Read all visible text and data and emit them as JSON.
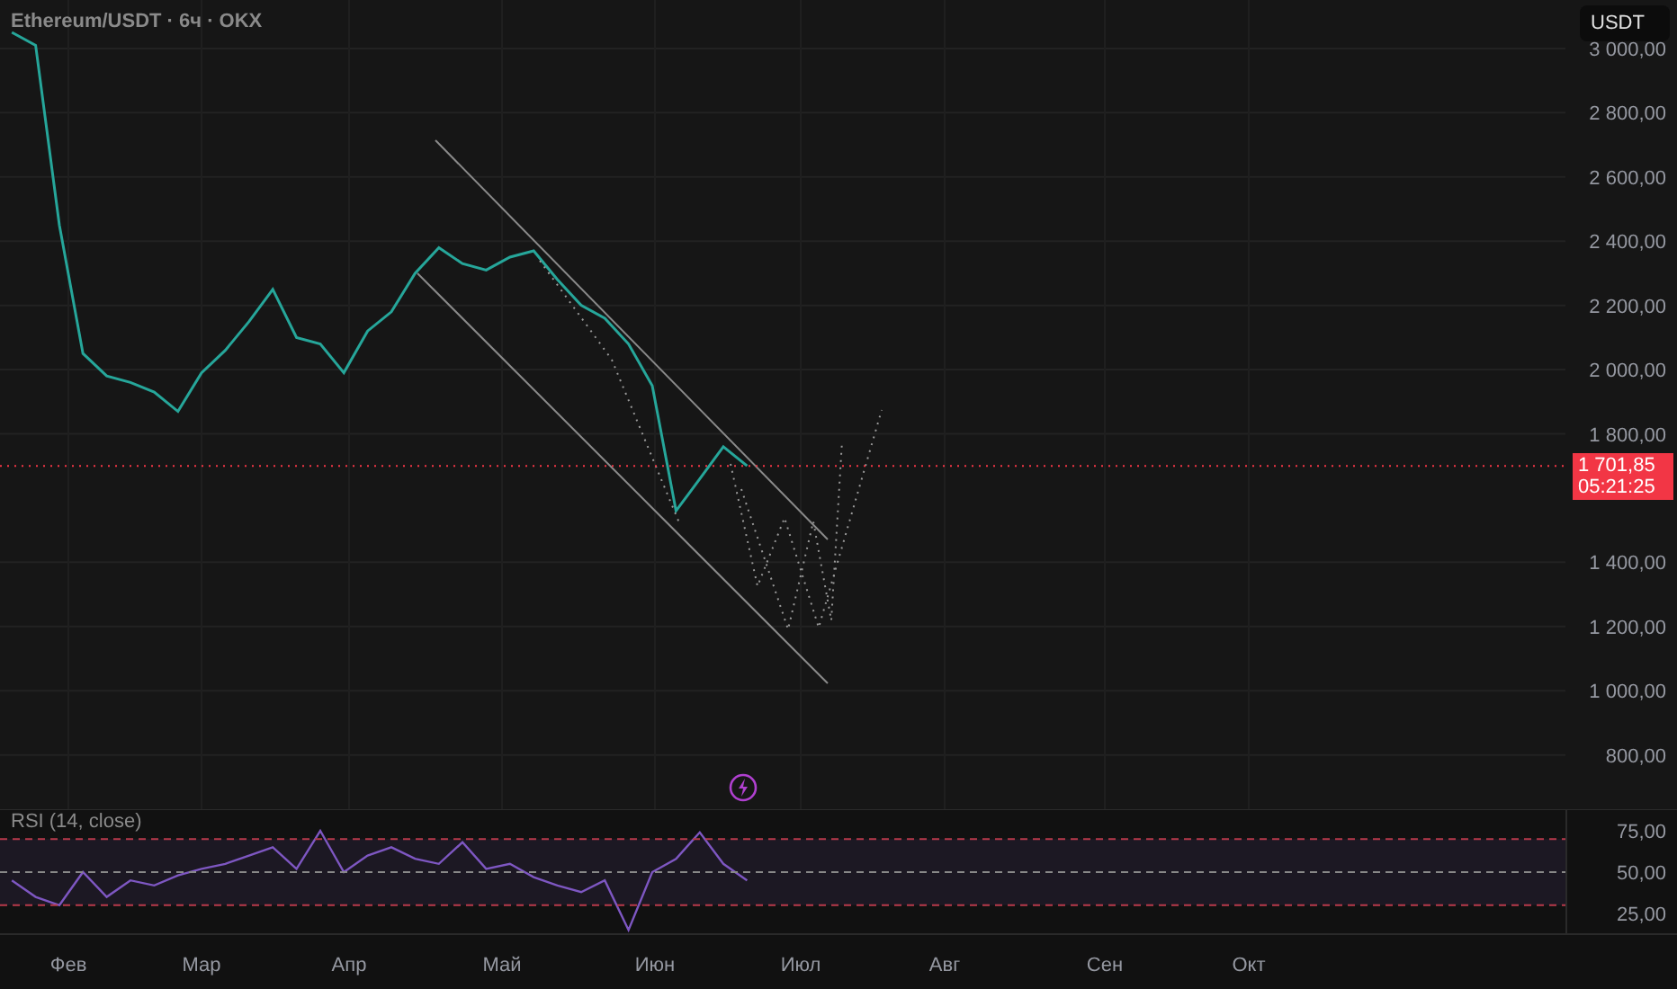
{
  "title": "Ethereum/USDT · 6ч · OKX",
  "currency_button": "USDT",
  "price_chart": {
    "chart_data": {
      "type": "line",
      "grid": true,
      "ylim": [
        631,
        3151
      ],
      "categories": [
        null,
        null,
        null,
        null,
        null,
        null,
        null,
        null,
        null,
        null,
        null,
        null,
        null,
        null,
        null,
        null,
        null,
        null,
        null,
        null,
        null,
        null,
        null,
        null,
        null,
        null,
        null,
        null,
        null,
        null,
        null,
        null,
        null,
        null,
        null,
        null,
        null,
        null,
        null,
        null,
        null,
        null,
        null,
        null,
        null,
        null,
        null,
        null,
        null,
        null,
        null,
        null,
        null,
        null,
        null,
        null,
        null,
        null,
        null,
        null,
        null,
        null,
        null,
        null,
        null,
        null
      ],
      "series": [
        {
          "color": "#26a69a",
          "values": [
            3050,
            3010,
            2450,
            2050,
            1980,
            1960,
            1930,
            1870,
            1990,
            2060,
            2150,
            2250,
            2100,
            2080,
            1990,
            2120,
            2180,
            2300,
            2380,
            2330,
            2310,
            2350,
            2370,
            2280,
            2200,
            2160,
            2080,
            1950,
            1560,
            1660,
            1760,
            1700,
            null,
            null,
            null,
            null,
            null,
            null,
            null,
            null,
            null,
            null,
            null,
            null,
            null,
            null,
            null,
            null,
            null,
            null,
            null,
            null,
            null,
            null,
            null,
            null,
            null,
            null,
            null,
            null,
            null,
            null,
            null,
            null,
            null,
            null
          ]
        }
      ],
      "yticks": [
        {
          "value": 3000,
          "label": "3 000,00"
        },
        {
          "value": 2800,
          "label": "2 800,00"
        },
        {
          "value": 2600,
          "label": "2 600,00"
        },
        {
          "value": 2400,
          "label": "2 400,00"
        },
        {
          "value": 2200,
          "label": "2 200,00"
        },
        {
          "value": 2000,
          "label": "2 000,00"
        },
        {
          "value": 1800,
          "label": "1 800,00"
        },
        {
          "value": 1400,
          "label": "1 400,00"
        },
        {
          "value": 1200,
          "label": "1 200,00"
        },
        {
          "value": 1000,
          "label": "1 000,00"
        },
        {
          "value": 800,
          "label": "800,00"
        }
      ]
    }
  },
  "last_price": {
    "price": "1 701,85",
    "countdown": "05:21:25"
  },
  "rsi": {
    "label": "RSI (14, close)",
    "chart_data": {
      "type": "line",
      "ylim": [
        12,
        88
      ],
      "categories": [
        null,
        null,
        null,
        null,
        null,
        null,
        null,
        null,
        null,
        null,
        null,
        null,
        null,
        null,
        null,
        null,
        null,
        null,
        null,
        null,
        null,
        null,
        null,
        null,
        null,
        null,
        null,
        null,
        null,
        null,
        null,
        null,
        null,
        null,
        null,
        null,
        null,
        null,
        null,
        null,
        null,
        null,
        null,
        null,
        null,
        null,
        null,
        null,
        null,
        null,
        null,
        null,
        null,
        null,
        null,
        null,
        null,
        null,
        null,
        null,
        null,
        null,
        null,
        null,
        null,
        null
      ],
      "series": [
        {
          "color": "#7e57c2",
          "values": [
            45,
            35,
            30,
            50,
            35,
            45,
            42,
            48,
            52,
            55,
            60,
            65,
            52,
            75,
            50,
            60,
            65,
            58,
            55,
            68,
            52,
            55,
            47,
            42,
            38,
            45,
            15,
            50,
            58,
            74,
            55,
            45,
            null,
            null,
            null,
            null,
            null,
            null,
            null,
            null,
            null,
            null,
            null,
            null,
            null,
            null,
            null,
            null,
            null,
            null,
            null,
            null,
            null,
            null,
            null,
            null,
            null,
            null,
            null,
            null,
            null,
            null,
            null,
            null,
            null,
            null
          ]
        }
      ],
      "yticks": [
        {
          "value": 75,
          "label": "75,00"
        },
        {
          "value": 50,
          "label": "50,00"
        },
        {
          "value": 25,
          "label": "25,00"
        }
      ]
    }
  },
  "time_axis": [
    "Фев",
    "Мар",
    "Апр",
    "Май",
    "Июн",
    "Июл",
    "Авг",
    "Сен",
    "Окт"
  ]
}
